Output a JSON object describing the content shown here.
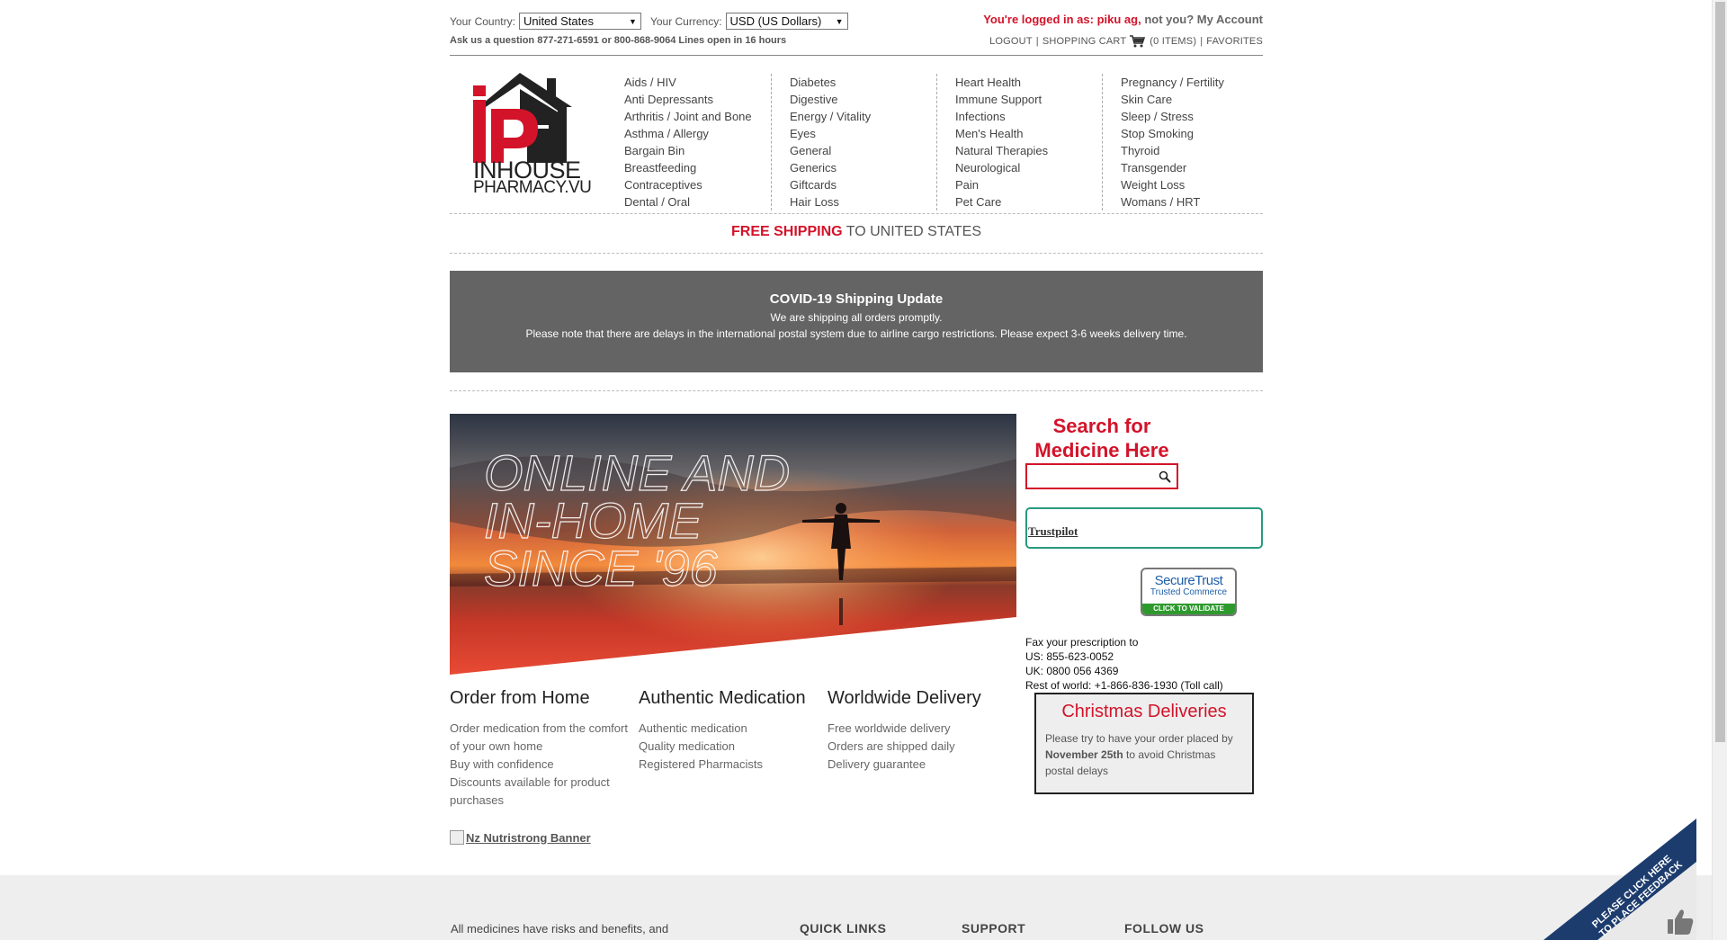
{
  "topbar": {
    "country_label": "Your Country:",
    "country_value": "United States",
    "currency_label": "Your Currency:",
    "currency_value": "USD (US Dollars)",
    "ask_line": "Ask us a question 877-271-6591 or 800-868-9064  Lines open in 16 hours",
    "logged_prefix": "You're logged in as: piku ag,",
    "logged_suffix": "not you? My Account",
    "logout": "LOGOUT",
    "cart": "SHOPPING CART",
    "items": "(0 ITEMS)",
    "favorites": "FAVORITES"
  },
  "logo": {
    "line1": "INHOUSE",
    "line2": "PHARMACY.VU"
  },
  "categories": {
    "col1": [
      "Aids / HIV",
      "Anti Depressants",
      "Arthritis / Joint and Bone",
      "Asthma / Allergy",
      "Bargain Bin",
      "Breastfeeding",
      "Contraceptives",
      "Dental / Oral"
    ],
    "col2": [
      "Diabetes",
      "Digestive",
      "Energy / Vitality",
      "Eyes",
      "General",
      "Generics",
      "Giftcards",
      "Hair Loss"
    ],
    "col3": [
      "Heart Health",
      "Immune Support",
      "Infections",
      "Men's Health",
      "Natural Therapies",
      "Neurological",
      "Pain",
      "Pet Care"
    ],
    "col4": [
      "Pregnancy / Fertility",
      "Skin Care",
      "Sleep / Stress",
      "Stop Smoking",
      "Thyroid",
      "Transgender",
      "Weight Loss",
      "Womans / HRT"
    ]
  },
  "free_shipping": {
    "bold": "FREE SHIPPING",
    "rest": " TO UNITED STATES"
  },
  "covid": {
    "title": "COVID-19 Shipping Update",
    "line1": "We are shipping all orders promptly.",
    "line2": "Please note that there are delays in the international postal system due to airline cargo restrictions. Please expect 3-6 weeks delivery time."
  },
  "hero": {
    "line1": "ONLINE AND",
    "line2": "IN-HOME",
    "line3": "SINCE '96"
  },
  "features": [
    {
      "title": "Order from Home",
      "lines": [
        "Order medication from the comfort",
        "of your own home",
        "Buy with confidence",
        "Discounts available for product",
        "purchases"
      ]
    },
    {
      "title": "Authentic Medication",
      "lines": [
        "Authentic medication",
        "Quality medication",
        "Registered Pharmacists"
      ]
    },
    {
      "title": "Worldwide Delivery",
      "lines": [
        "Free worldwide delivery",
        "Orders are shipped daily",
        "Delivery guarantee"
      ]
    }
  ],
  "nz_banner": "Nz Nutristrong Banner",
  "search": {
    "title": "Search for Medicine Here",
    "placeholder": ""
  },
  "trustpilot": "Trustpilot",
  "securetrust": {
    "line1": "SecureTrust",
    "line2": "Trusted Commerce",
    "line3": "CLICK TO VALIDATE"
  },
  "fax": {
    "line1": "Fax your prescription to",
    "line2": "US: 855-623-0052",
    "line3": "UK: 0800 056 4369",
    "line4": "Rest of world: +1-866-836-1930 (Toll call)"
  },
  "xmas": {
    "title": "Christmas Deliveries",
    "pre": "Please try to have your order placed by ",
    "bold": "November 25th",
    "post": " to avoid Christmas postal delays"
  },
  "footer": {
    "disclaimer": "All medicines have risks and benefits, and",
    "quick_links": "QUICK LINKS",
    "support": "SUPPORT",
    "follow_us": "FOLLOW US"
  },
  "feedback": {
    "line1": "PLEASE CLICK HERE",
    "line2": "TO PLACE FEEDBACK"
  },
  "colors": {
    "brand_red": "#d3132a",
    "covid_bg": "#646464",
    "trust_green": "#2a9a7e"
  }
}
